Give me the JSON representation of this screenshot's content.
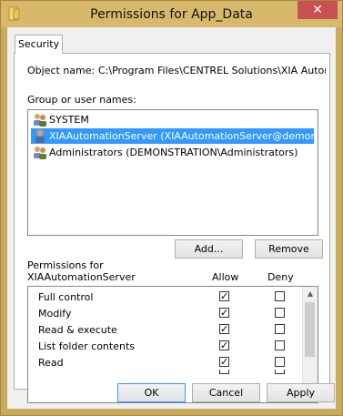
{
  "window": {
    "title": "Permissions for App_Data",
    "close_glyph": "✕"
  },
  "tabs": [
    {
      "label": "Security"
    }
  ],
  "object": {
    "label": "Object name:",
    "value": "C:\\Program Files\\CENTREL Solutions\\XIA Automa"
  },
  "groups": {
    "label": "Group or user names:",
    "items": [
      {
        "label": "SYSTEM",
        "icon": "users-icon",
        "selected": false
      },
      {
        "label": "XIAAutomationServer (XIAAutomationServer@demonstratio...",
        "icon": "user-icon",
        "selected": true
      },
      {
        "label": "Administrators (DEMONSTRATION\\Administrators)",
        "icon": "users-icon",
        "selected": false
      }
    ]
  },
  "buttons": {
    "add": "Add...",
    "remove": "Remove",
    "ok": "OK",
    "cancel": "Cancel",
    "apply": "Apply"
  },
  "permissions": {
    "label_line1": "Permissions for",
    "label_line2": "XIAAutomationServer",
    "allow_header": "Allow",
    "deny_header": "Deny",
    "rows": [
      {
        "name": "Full control",
        "allow": true,
        "deny": false
      },
      {
        "name": "Modify",
        "allow": true,
        "deny": false
      },
      {
        "name": "Read & execute",
        "allow": true,
        "deny": false
      },
      {
        "name": "List folder contents",
        "allow": true,
        "deny": false
      },
      {
        "name": "Read",
        "allow": true,
        "deny": false
      }
    ]
  },
  "colors": {
    "title_bar": "#d8b96c",
    "close_button": "#c75050",
    "selection": "#3399ff"
  }
}
